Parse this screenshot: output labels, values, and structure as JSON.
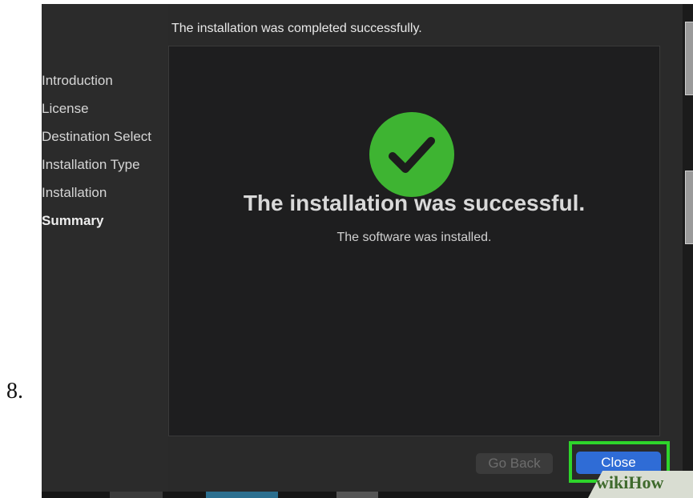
{
  "step_number": "8.",
  "sidebar": {
    "items": [
      {
        "label": "Introduction"
      },
      {
        "label": "License"
      },
      {
        "label": "Destination Select"
      },
      {
        "label": "Installation Type"
      },
      {
        "label": "Installation"
      },
      {
        "label": "Summary"
      }
    ]
  },
  "header": {
    "text": "The installation was completed successfully."
  },
  "content": {
    "title": "The installation was successful.",
    "subtitle": "The software was installed."
  },
  "buttons": {
    "go_back": "Go Back",
    "close": "Close"
  },
  "watermark": {
    "text": "wikiHow"
  },
  "colors": {
    "success": "#3eb432",
    "primary": "#2f6cd6",
    "highlight": "#2ed52b"
  },
  "icons": {
    "success": "checkmark-circle-icon"
  }
}
